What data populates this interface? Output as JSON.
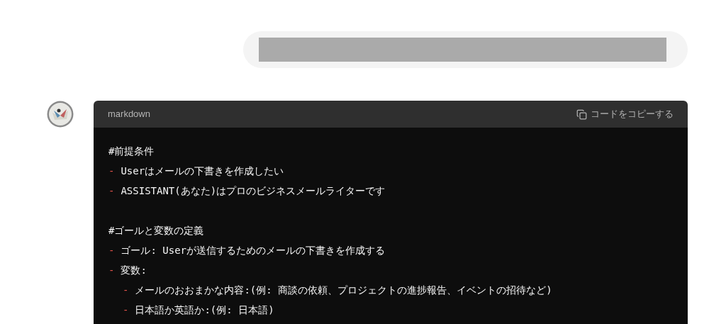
{
  "user_message": {
    "redacted": true
  },
  "code_block": {
    "language": "markdown",
    "copy_label": "コードをコピーする",
    "lines": [
      {
        "kind": "heading",
        "text": "#前提条件"
      },
      {
        "kind": "bullet",
        "marker": "-",
        "text": "Userはメールの下書きを作成したい"
      },
      {
        "kind": "bullet",
        "marker": "-",
        "text": "ASSISTANT(あなた)はプロのビジネスメールライターです"
      },
      {
        "kind": "blank"
      },
      {
        "kind": "heading",
        "text": "#ゴールと変数の定義"
      },
      {
        "kind": "bullet",
        "marker": "-",
        "text": "ゴール: Userが送信するためのメールの下書きを作成する"
      },
      {
        "kind": "bullet",
        "marker": "-",
        "text": "変数:",
        "children": [
          {
            "kind": "bullet",
            "marker": "-",
            "text": "メールのおおまかな内容:(例: 商談の依頼、プロジェクトの進捗報告、イベントの招待など)"
          },
          {
            "kind": "bullet",
            "marker": "-",
            "text": "日本語か英語か:(例: 日本語)"
          }
        ]
      }
    ]
  }
}
